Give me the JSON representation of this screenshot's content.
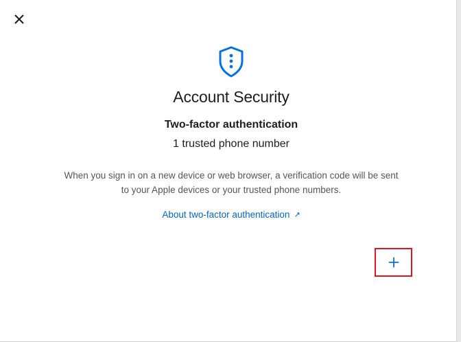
{
  "dialog": {
    "close_icon": "close-icon",
    "header_icon": "shield-icon",
    "title": "Account Security",
    "section_title": "Two-factor authentication",
    "status": "1 trusted phone number",
    "description": "When you sign in on a new device or web browser, a verification code will be sent to your Apple devices or your trusted phone numbers.",
    "learn_link": "About two-factor authentication",
    "learn_link_arrow": "↗",
    "add_icon": "plus-icon"
  },
  "colors": {
    "accent": "#0066cc",
    "title_text": "#1d1d1f",
    "body_text": "#555555",
    "highlight_box": "#e0161b"
  }
}
